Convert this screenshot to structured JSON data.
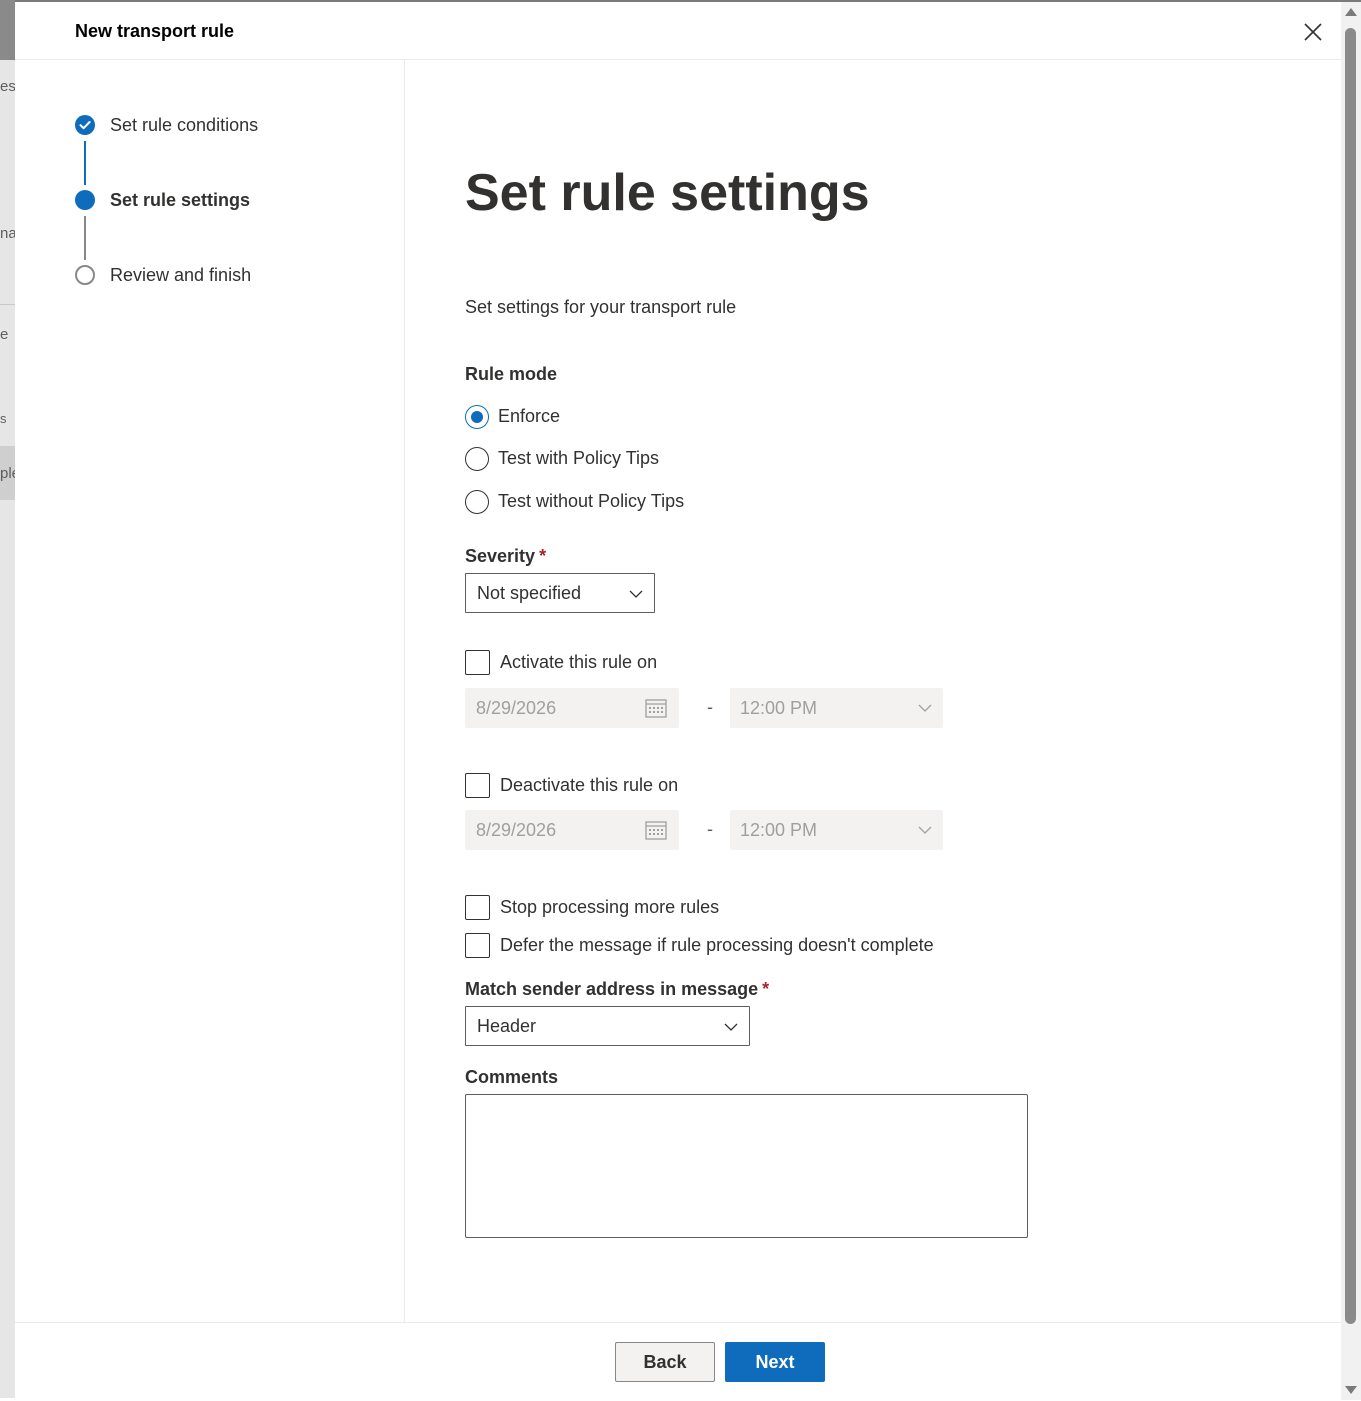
{
  "backdrop": {
    "fragments": [
      "es",
      "na",
      "e",
      "s",
      "ple"
    ]
  },
  "panel": {
    "title": "New transport rule",
    "close_icon": "close-icon"
  },
  "steps": [
    {
      "label": "Set rule conditions",
      "state": "completed"
    },
    {
      "label": "Set rule settings",
      "state": "current"
    },
    {
      "label": "Review and finish",
      "state": "pending"
    }
  ],
  "main": {
    "title": "Set rule settings",
    "description": "Set settings for your transport rule",
    "rule_mode": {
      "label": "Rule mode",
      "options": [
        "Enforce",
        "Test with Policy Tips",
        "Test without Policy Tips"
      ],
      "selected": "Enforce"
    },
    "severity": {
      "label": "Severity",
      "required_mark": "*",
      "value": "Not specified"
    },
    "activate": {
      "label": "Activate this rule on",
      "checked": false,
      "date": "8/29/2026",
      "separator": "-",
      "time": "12:00 PM"
    },
    "deactivate": {
      "label": "Deactivate this rule on",
      "checked": false,
      "date": "8/29/2026",
      "separator": "-",
      "time": "12:00 PM"
    },
    "stop_processing": {
      "label": "Stop processing more rules",
      "checked": false
    },
    "defer_message": {
      "label": "Defer the message if rule processing doesn't complete",
      "checked": false
    },
    "match_sender": {
      "label": "Match sender address in message",
      "required_mark": "*",
      "value": "Header"
    },
    "comments": {
      "label": "Comments",
      "value": ""
    }
  },
  "footer": {
    "back_label": "Back",
    "next_label": "Next"
  },
  "colors": {
    "accent": "#0f6cbd",
    "required": "#a4262c",
    "disabled_bg": "#f3f2f1"
  }
}
